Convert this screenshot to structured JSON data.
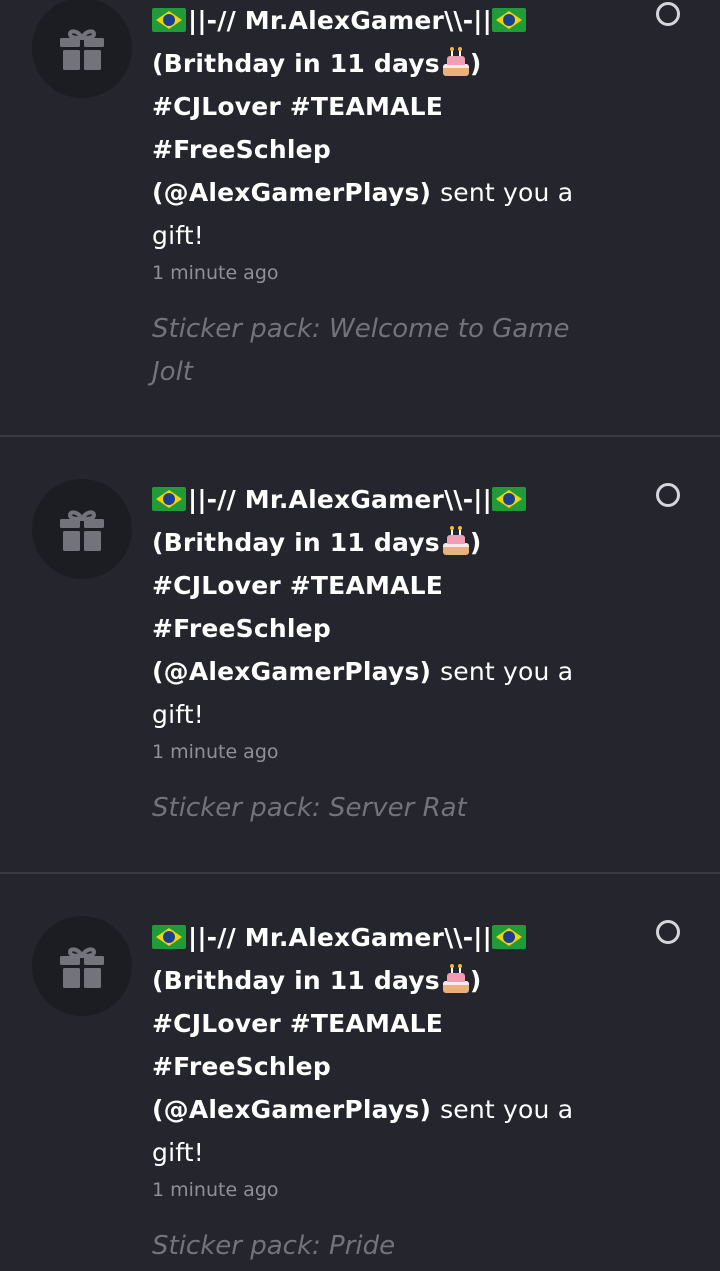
{
  "notifications": [
    {
      "sender_line1": "||-// Mr.AlexGamer\\\\-||",
      "sender_line2_prefix": "(Brithday in 11 days",
      "sender_line2_suffix": ")",
      "sender_line3": "#CJLover #TEAMALE",
      "sender_line4": "#FreeSchlep",
      "sender_handle": "(@AlexGamerPlays)",
      "action_text": "sent you a",
      "action_text_2": "gift!",
      "timestamp": "1 minute ago",
      "item": "Sticker pack: Welcome to Game Jolt",
      "icon": "gift-icon",
      "read_state_icon": "unread-circle-icon"
    },
    {
      "sender_line1": "||-// Mr.AlexGamer\\\\-||",
      "sender_line2_prefix": "(Brithday in 11 days",
      "sender_line2_suffix": ")",
      "sender_line3": "#CJLover #TEAMALE",
      "sender_line4": "#FreeSchlep",
      "sender_handle": "(@AlexGamerPlays)",
      "action_text": "sent you a",
      "action_text_2": "gift!",
      "timestamp": "1 minute ago",
      "item": "Sticker pack: Server Rat",
      "icon": "gift-icon",
      "read_state_icon": "unread-circle-icon"
    },
    {
      "sender_line1": "||-// Mr.AlexGamer\\\\-||",
      "sender_line2_prefix": "(Brithday in 11 days",
      "sender_line2_suffix": ")",
      "sender_line3": "#CJLover #TEAMALE",
      "sender_line4": "#FreeSchlep",
      "sender_handle": "(@AlexGamerPlays)",
      "action_text": "sent you a",
      "action_text_2": "gift!",
      "timestamp": "1 minute ago",
      "item": "Sticker pack: Pride",
      "icon": "gift-icon",
      "read_state_icon": "unread-circle-icon"
    }
  ],
  "colors": {
    "background": "#24252d",
    "avatar_bg": "#1c1d23",
    "divider": "#393a43",
    "text_primary": "#ffffff",
    "text_muted": "#8f9098",
    "text_item": "#72737b",
    "flag_green": "#1f9b3a",
    "flag_yellow": "#f6d20a",
    "flag_blue": "#1b3f8f"
  }
}
